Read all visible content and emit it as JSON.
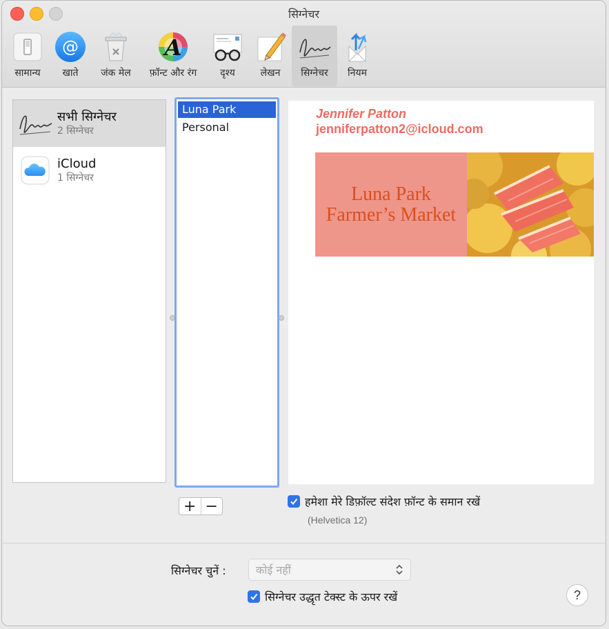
{
  "window": {
    "title": "सिग्नेचर"
  },
  "toolbar": {
    "items": [
      {
        "label": "सामान्य",
        "icon": "switch-icon"
      },
      {
        "label": "खाते",
        "icon": "at-sign-icon"
      },
      {
        "label": "जंक मेल",
        "icon": "trash-bin-icon"
      },
      {
        "label": "फ़ॉन्ट और रंग",
        "icon": "font-color-icon"
      },
      {
        "label": "दृश्य",
        "icon": "glasses-icon"
      },
      {
        "label": "लेखन",
        "icon": "pencil-icon"
      },
      {
        "label": "सिग्नेचर",
        "icon": "signature-icon",
        "active": true
      },
      {
        "label": "नियम",
        "icon": "rules-icon"
      }
    ]
  },
  "accounts": [
    {
      "name": "सभी सिग्नेचर",
      "count": "2 सिग्नेचर",
      "icon": "signature-icon",
      "selected": true
    },
    {
      "name": "iCloud",
      "count": "1 सिग्नेचर",
      "icon": "icloud-icon",
      "selected": false
    }
  ],
  "signatures": [
    {
      "name": "Luna Park",
      "selected": true
    },
    {
      "name": "Personal",
      "selected": false
    }
  ],
  "preview": {
    "name": "Jennifer Patton",
    "email": "jenniferpatton2@icloud.com",
    "banner_line1": "Luna Park",
    "banner_line2": "Farmer’s Market",
    "accent_color": "#ef6a62",
    "banner_bg": "#ef968a",
    "banner_text_color": "#d84f1e"
  },
  "buttons": {
    "add": "+",
    "remove": "−",
    "help": "?"
  },
  "options": {
    "match_font_label": "हमेशा मेरे डिफ़ॉल्ट संदेश फ़ॉन्ट के समान रखें",
    "match_font_checked": true,
    "font_note": "(Helvetica 12)",
    "choose_label": "सिग्नेचर चुनें :",
    "choose_value": "कोई नहीं",
    "above_quote_label": "सिग्नेचर उद्धृत टेक्स्ट के ऊपर रखें",
    "above_quote_checked": true
  },
  "colors": {
    "checkbox": "#2e74e8",
    "selection": "#2a63d6",
    "focus_ring": "#7fa7f0"
  }
}
